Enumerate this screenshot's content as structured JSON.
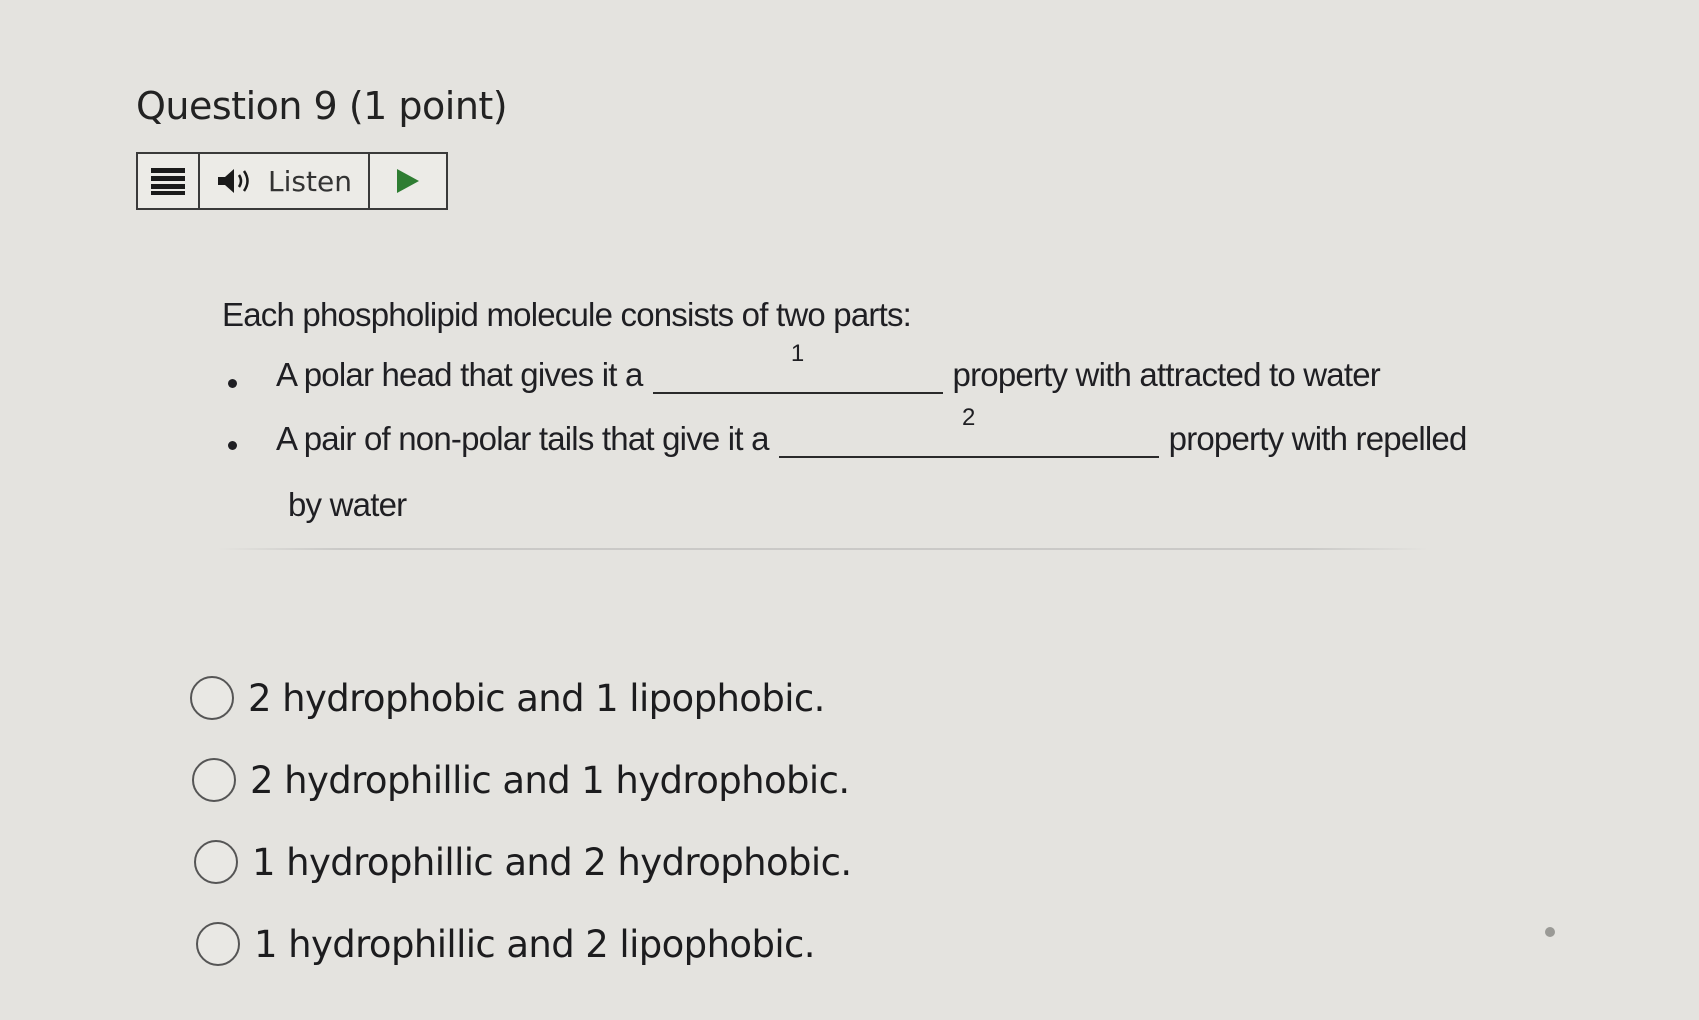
{
  "question": {
    "title": "Question 9",
    "points": "(1 point)"
  },
  "toolbar": {
    "menu_icon": "hamburger-menu-icon",
    "listen_icon": "speaker-icon",
    "listen_label": "Listen",
    "play_icon": "play-icon",
    "play_color": "#2e7d32"
  },
  "passage": {
    "intro": "Each phospholipid molecule consists of two parts:",
    "bullet1": {
      "before": "A polar head that gives it a",
      "blank_number": "1",
      "after": "property with attracted to water"
    },
    "bullet2": {
      "before": "A pair of non-polar tails that give it a",
      "blank_number": "2",
      "after": "property with repelled",
      "continuation": "by water"
    }
  },
  "options": [
    {
      "label": "2 hydrophobic and 1 lipophobic.",
      "selected": false
    },
    {
      "label": "2 hydrophillic and 1 hydrophobic.",
      "selected": false
    },
    {
      "label": "1 hydrophillic and 2 hydrophobic.",
      "selected": false
    },
    {
      "label": "1 hydrophillic and 2 lipophobic.",
      "selected": false
    }
  ]
}
